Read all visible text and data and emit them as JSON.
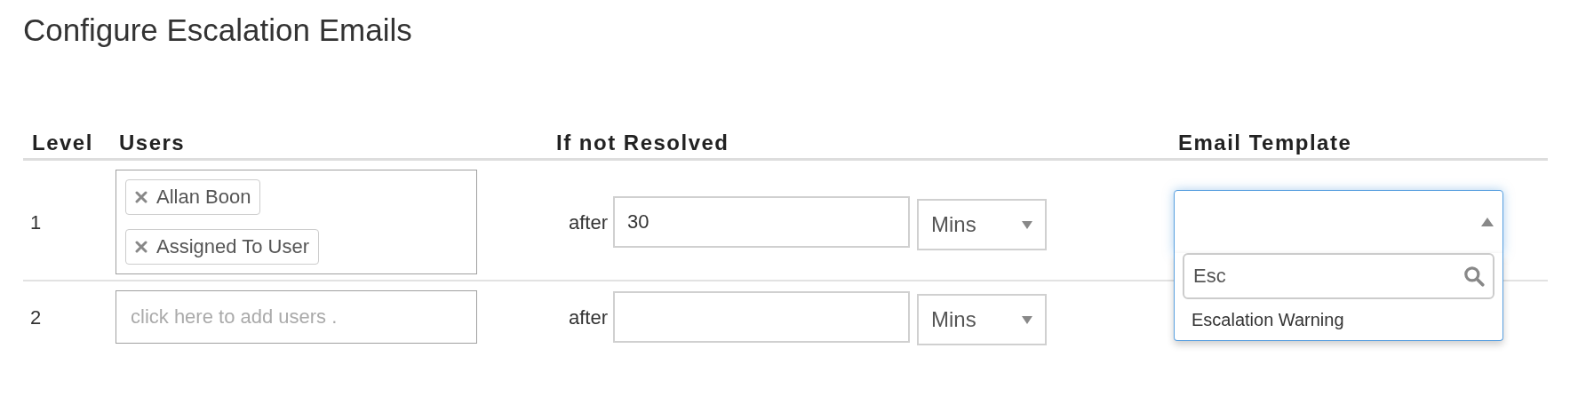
{
  "title": "Configure Escalation Emails",
  "columns": [
    "Level",
    "Users",
    "If not Resolved",
    "Email Template"
  ],
  "rows": [
    {
      "level": "1",
      "users": [
        "Allan Boon",
        "Assigned To User"
      ],
      "after_label": "after",
      "amount": "30",
      "unit": "Mins",
      "template": {
        "expanded": true,
        "search": "Esc",
        "options": [
          "Escalation Warning"
        ]
      }
    },
    {
      "level": "2",
      "users_placeholder": "click here to add users .",
      "after_label": "after",
      "unit": "Mins"
    }
  ]
}
